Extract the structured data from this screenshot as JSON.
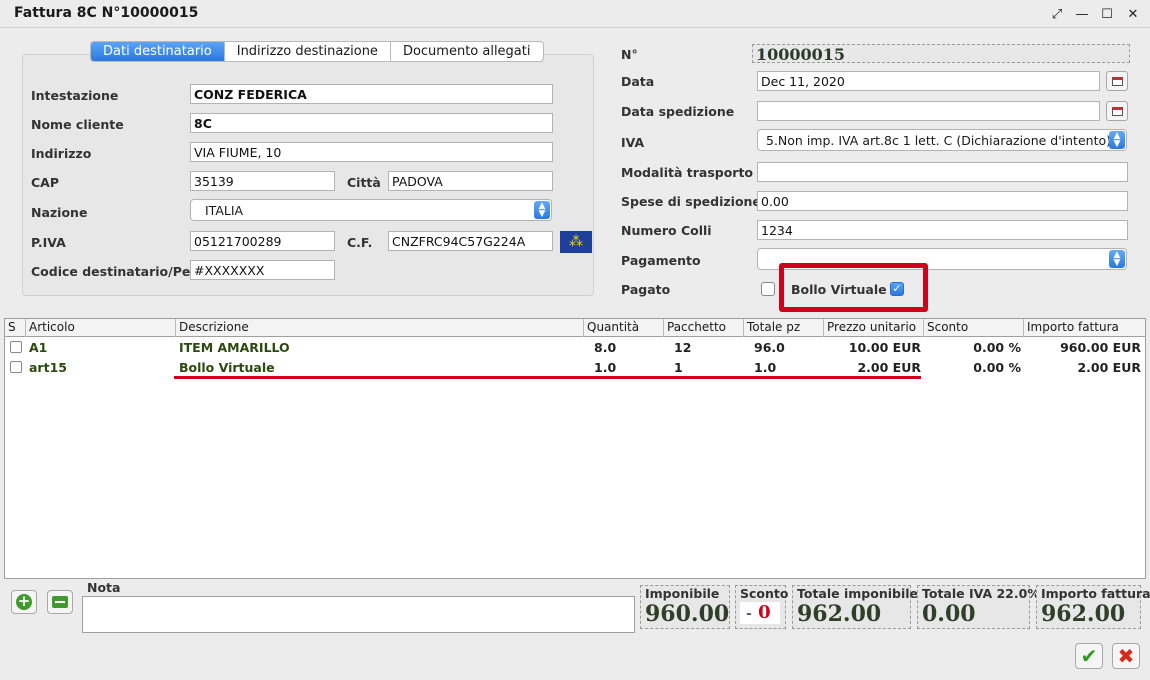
{
  "window": {
    "title": "Fattura 8C N°10000015"
  },
  "tabs": [
    {
      "label": "Dati destinatario",
      "active": true
    },
    {
      "label": "Indirizzo destinazione",
      "active": false
    },
    {
      "label": "Documento allegati",
      "active": false
    }
  ],
  "recipient": {
    "intestazione_label": "Intestazione",
    "intestazione": "CONZ FEDERICA",
    "nome_cliente_label": "Nome cliente",
    "nome_cliente": "8C",
    "indirizzo_label": "Indirizzo",
    "indirizzo": "VIA FIUME, 10",
    "cap_label": "CAP",
    "cap": "35139",
    "citta_label": "Città",
    "citta": "PADOVA",
    "nazione_label": "Nazione",
    "nazione": "ITALIA",
    "piva_label": "P.IVA",
    "piva": "05121700289",
    "cf_label": "C.F.",
    "cf": "CNZFRC94C57G224A",
    "codice_label": "Codice destinatario/Pec",
    "codice": "#XXXXXXX"
  },
  "invoice": {
    "numero_label": "N°",
    "numero": "10000015",
    "data_label": "Data",
    "data": "Dec 11, 2020",
    "data_spedizione_label": "Data spedizione",
    "data_spedizione": "",
    "iva_label": "IVA",
    "iva": "5.Non imp. IVA art.8c 1 lett. C (Dichiarazione d'intento)",
    "modalita_label": "Modalità trasporto",
    "modalita": "",
    "spese_label": "Spese di spedizione",
    "spese": "0.00",
    "colli_label": "Numero Colli",
    "colli": "1234",
    "pagamento_label": "Pagamento",
    "pagamento": "",
    "pagato_label": "Pagato",
    "pagato": false,
    "bollo_label": "Bollo Virtuale",
    "bollo": true
  },
  "table": {
    "columns": [
      "S",
      "Articolo",
      "Descrizione",
      "Quantità",
      "Pacchetto",
      "Totale pz",
      "Prezzo unitario",
      "Sconto",
      "Importo fattura"
    ],
    "rows": [
      {
        "articolo": "A1",
        "descrizione": "ITEM AMARILLO",
        "quantita": "8.0",
        "pacchetto": "12",
        "totale_pz": "96.0",
        "prezzo": "10.00 EUR",
        "sconto": "0.00 %",
        "importo": "960.00 EUR"
      },
      {
        "articolo": "art15",
        "descrizione": "Bollo Virtuale",
        "quantita": "1.0",
        "pacchetto": "1",
        "totale_pz": "1.0",
        "prezzo": "2.00 EUR",
        "sconto": "0.00 %",
        "importo": "2.00 EUR"
      }
    ]
  },
  "footer": {
    "nota_label": "Nota",
    "nota": "",
    "imponibile_label": "Imponibile",
    "imponibile": "960.00",
    "sconto_label": "Sconto",
    "sconto_prefix": "-",
    "sconto": "0",
    "totale_imponibile_label": "Totale imponibile",
    "totale_imponibile": "962.00",
    "totale_iva_label": "Totale IVA 22.0%",
    "totale_iva": "0.00",
    "importo_fattura_label": "Importo fattura",
    "importo_fattura": "962.00"
  },
  "colors": {
    "accent": "#2a78e0",
    "highlight": "#d0021b",
    "value_text": "#2f3f2a"
  },
  "icons": [
    "fullscreen-icon",
    "minimize-icon",
    "maximize-icon",
    "close-icon",
    "calendar-icon",
    "eu-flag-icon",
    "add-icon",
    "remove-icon",
    "confirm-icon",
    "cancel-icon"
  ]
}
